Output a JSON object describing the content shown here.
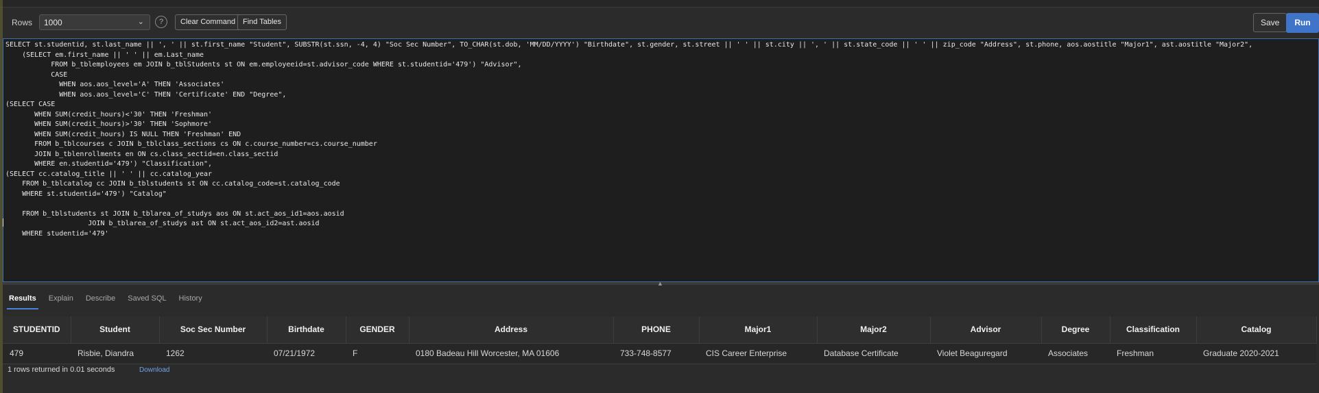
{
  "toolbar": {
    "rows_label": "Rows",
    "rows_value": "1000",
    "help_icon": "?",
    "clear_label": "Clear Command",
    "find_label": "Find Tables",
    "save_label": "Save",
    "run_label": "Run"
  },
  "editor": {
    "lines": [
      "SELECT st.studentid, st.last_name || ', ' || st.first_name \"Student\", SUBSTR(st.ssn, -4, 4) \"Soc Sec Number\", TO_CHAR(st.dob, 'MM/DD/YYYY') \"Birthdate\", st.gender, st.street || ' ' || st.city || ', ' || st.state_code || ' ' || zip_code \"Address\", st.phone, aos.aostitle \"Major1\", ast.aostitle \"Major2\",",
      "    (SELECT em.first_name || ' ' || em.Last_name",
      "           FROM b_tblemployees em JOIN b_tblStudents st ON em.employeeid=st.advisor_code WHERE st.studentid='479') \"Advisor\",",
      "           CASE",
      "             WHEN aos.aos_level='A' THEN 'Associates'",
      "             WHEN aos.aos_level='C' THEN 'Certificate' END \"Degree\",",
      "(SELECT CASE",
      "       WHEN SUM(credit_hours)<'30' THEN 'Freshman'",
      "       WHEN SUM(credit_hours)>'30' THEN 'Sophmore'",
      "       WHEN SUM(credit_hours) IS NULL THEN 'Freshman' END",
      "       FROM b_tblcourses c JOIN b_tblclass_sections cs ON c.course_number=cs.course_number",
      "       JOIN b_tblenrollments en ON cs.class_sectid=en.class_sectid",
      "       WHERE en.studentid='479') \"Classification\",",
      "(SELECT cc.catalog_title || ' ' || cc.catalog_year",
      "    FROM b_tblcatalog cc JOIN b_tblstudents st ON cc.catalog_code=st.catalog_code",
      "    WHERE st.studentid='479') \"Catalog\"",
      "",
      "    FROM b_tblstudents st JOIN b_tblarea_of_studys aos ON st.act_aos_id1=aos.aosid",
      "                    JOIN b_tblarea_of_studys ast ON st.act_aos_id2=ast.aosid",
      "    WHERE studentid='479'"
    ]
  },
  "tabs": [
    "Results",
    "Explain",
    "Describe",
    "Saved SQL",
    "History"
  ],
  "results": {
    "columns": [
      "STUDENTID",
      "Student",
      "Soc Sec Number",
      "Birthdate",
      "GENDER",
      "Address",
      "PHONE",
      "Major1",
      "Major2",
      "Advisor",
      "Degree",
      "Classification",
      "Catalog"
    ],
    "rows": [
      [
        "479",
        "Risbie, Diandra",
        "1262",
        "07/21/1972",
        "F",
        "0180 Badeau Hill Worcester, MA 01606",
        "733-748-8577",
        "CIS Career Enterprise",
        "Database Certificate",
        "Violet Beaguregard",
        "Associates",
        "Freshman",
        "Graduate 2020-2021"
      ]
    ]
  },
  "status": {
    "text": "1 rows returned in 0.01 seconds",
    "download_label": "Download"
  },
  "colors": {
    "accent": "#3f74c9",
    "background": "#2b2b2b",
    "editor_bg": "#1e1e1e"
  }
}
